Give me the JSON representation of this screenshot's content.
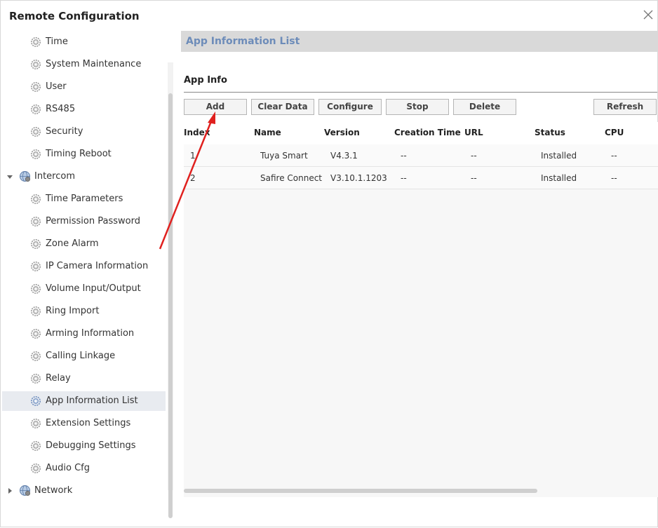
{
  "window": {
    "title": "Remote Configuration"
  },
  "sidebar": {
    "items": [
      {
        "label": "Time",
        "kind": "leaf",
        "icon": "gear-icon"
      },
      {
        "label": "System Maintenance",
        "kind": "leaf",
        "icon": "gear-icon"
      },
      {
        "label": "User",
        "kind": "leaf",
        "icon": "gear-icon"
      },
      {
        "label": "RS485",
        "kind": "leaf",
        "icon": "gear-icon"
      },
      {
        "label": "Security",
        "kind": "leaf",
        "icon": "gear-icon"
      },
      {
        "label": "Timing Reboot",
        "kind": "leaf",
        "icon": "gear-icon"
      },
      {
        "label": "Intercom",
        "kind": "group",
        "icon": "globe-icon",
        "expanded": true
      },
      {
        "label": "Time Parameters",
        "kind": "leaf",
        "icon": "gear-icon"
      },
      {
        "label": "Permission Password",
        "kind": "leaf",
        "icon": "gear-icon"
      },
      {
        "label": "Zone Alarm",
        "kind": "leaf",
        "icon": "gear-icon"
      },
      {
        "label": "IP Camera Information",
        "kind": "leaf",
        "icon": "gear-icon"
      },
      {
        "label": "Volume Input/Output",
        "kind": "leaf",
        "icon": "gear-icon"
      },
      {
        "label": "Ring Import",
        "kind": "leaf",
        "icon": "gear-icon"
      },
      {
        "label": "Arming Information",
        "kind": "leaf",
        "icon": "gear-icon"
      },
      {
        "label": "Calling Linkage",
        "kind": "leaf",
        "icon": "gear-icon"
      },
      {
        "label": "Relay",
        "kind": "leaf",
        "icon": "gear-icon"
      },
      {
        "label": "App Information List",
        "kind": "leaf",
        "icon": "gear-icon",
        "selected": true
      },
      {
        "label": "Extension Settings",
        "kind": "leaf",
        "icon": "gear-icon"
      },
      {
        "label": "Debugging Settings",
        "kind": "leaf",
        "icon": "gear-icon"
      },
      {
        "label": "Audio Cfg",
        "kind": "leaf",
        "icon": "gear-icon"
      },
      {
        "label": "Network",
        "kind": "group",
        "icon": "globe-icon",
        "expanded": false
      }
    ]
  },
  "main": {
    "section_title": "App Information List",
    "subheading": "App Info",
    "buttons": {
      "add": "Add",
      "clear_data": "Clear Data",
      "configure": "Configure",
      "stop": "Stop",
      "delete": "Delete",
      "refresh": "Refresh"
    },
    "table": {
      "columns": [
        "Index",
        "Name",
        "Version",
        "Creation Time",
        "URL",
        "Status",
        "CPU"
      ],
      "rows": [
        [
          "1",
          "Tuya Smart",
          "V4.3.1",
          "--",
          "--",
          "Installed",
          "--"
        ],
        [
          "2",
          "Safire Connect",
          "V3.10.1.1203",
          "--",
          "--",
          "Installed",
          "--"
        ]
      ]
    }
  },
  "colors": {
    "section_title": "#6d8cb9",
    "selected_row": "#e8ebf0",
    "annotation_arrow": "#e0201e"
  }
}
